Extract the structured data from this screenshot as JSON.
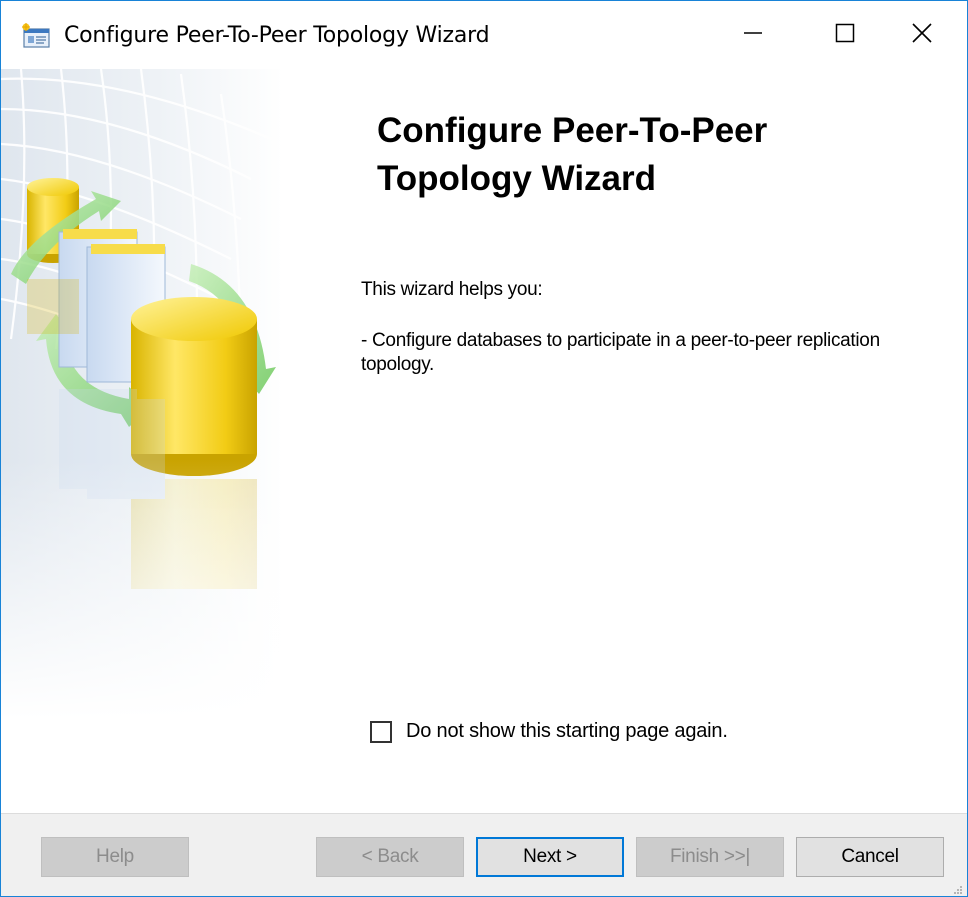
{
  "window": {
    "title": "Configure Peer-To-Peer Topology Wizard"
  },
  "page": {
    "title": "Configure Peer-To-Peer Topology Wizard",
    "intro": "This wizard helps you:",
    "bullet": "- Configure databases to participate in a peer-to-peer replication topology.",
    "checkbox_label": "Do not show this starting page again.",
    "checkbox_checked": false
  },
  "footer": {
    "help_label": "Help",
    "back_label": "< Back",
    "next_label": "Next >",
    "finish_label": "Finish >>|",
    "cancel_label": "Cancel"
  },
  "icons": {
    "app": "wizard-app-icon",
    "minimize": "minimize-icon",
    "maximize": "maximize-icon",
    "close": "close-icon",
    "side": "database-replication-illustration"
  },
  "colors": {
    "window_border": "#1883d7",
    "default_button_border": "#0078d7",
    "disabled_text": "#8c8c8c",
    "footer_bg": "#f0f0f0"
  }
}
